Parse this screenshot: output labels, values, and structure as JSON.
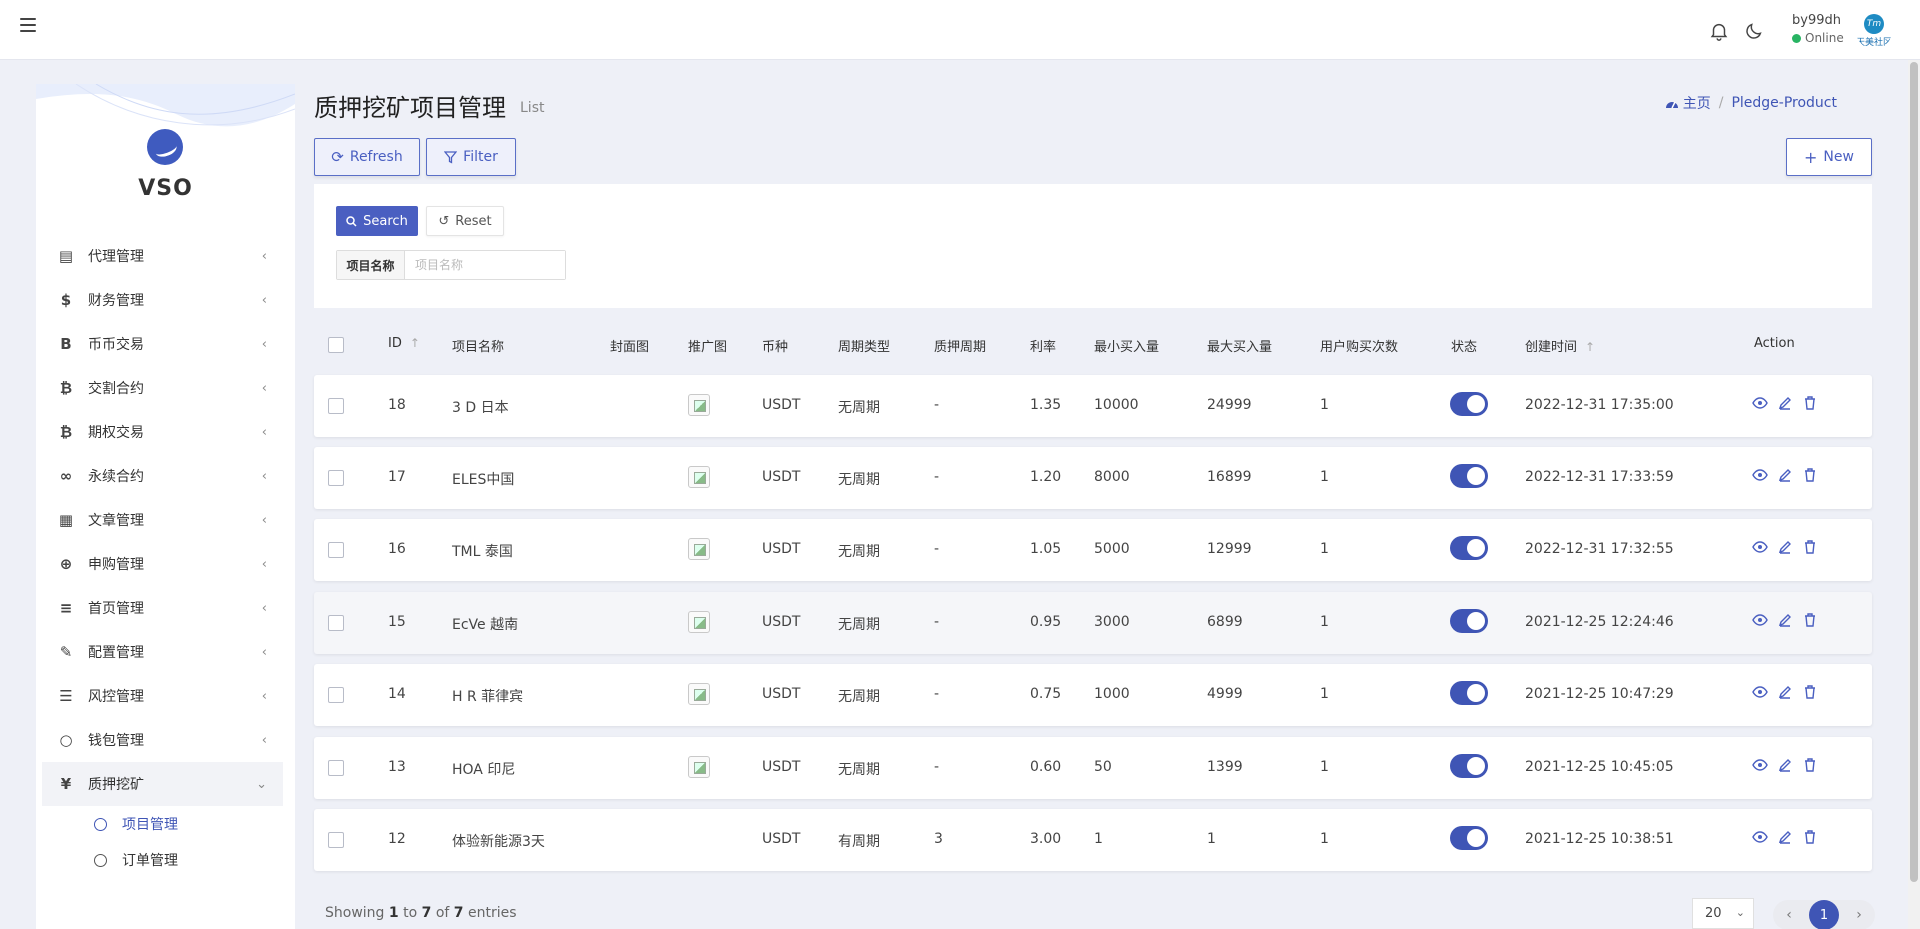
{
  "topbar": {
    "user_name": "by99dh",
    "user_status": "Online",
    "avatar_caption": "天美社区",
    "avatar_logo": "Tm"
  },
  "sidebar": {
    "logo_text": "VSO",
    "items": [
      {
        "label": "代理管理",
        "icon": "id-card-icon",
        "glyph": "▤"
      },
      {
        "label": "财务管理",
        "icon": "dollar-icon",
        "glyph": "$"
      },
      {
        "label": "币币交易",
        "icon": "bitcoin-b-icon",
        "glyph": "B"
      },
      {
        "label": "交割合约",
        "icon": "bitcoin-icon",
        "glyph": "₿"
      },
      {
        "label": "期权交易",
        "icon": "bitcoin-icon",
        "glyph": "₿"
      },
      {
        "label": "永续合约",
        "icon": "link-icon",
        "glyph": "∞"
      },
      {
        "label": "文章管理",
        "icon": "newspaper-icon",
        "glyph": "▦"
      },
      {
        "label": "申购管理",
        "icon": "lifebuoy-icon",
        "glyph": "⊕"
      },
      {
        "label": "首页管理",
        "icon": "list-icon",
        "glyph": "≡"
      },
      {
        "label": "配置管理",
        "icon": "wrench-icon",
        "glyph": "✎"
      },
      {
        "label": "风控管理",
        "icon": "indent-icon",
        "glyph": "☰"
      },
      {
        "label": "钱包管理",
        "icon": "circle-icon",
        "glyph": "○"
      },
      {
        "label": "质押挖矿",
        "icon": "yen-icon",
        "glyph": "¥"
      }
    ],
    "submenu": [
      {
        "label": "项目管理",
        "active": true
      },
      {
        "label": "订单管理",
        "active": false
      }
    ]
  },
  "header": {
    "title": "质押挖矿项目管理",
    "subtitle": "List",
    "breadcrumb_home": "主页",
    "breadcrumb_current": "Pledge-Product"
  },
  "toolbar": {
    "refresh_label": "Refresh",
    "filter_label": "Filter",
    "new_label": "New"
  },
  "filter": {
    "search_label": "Search",
    "reset_label": "Reset",
    "field_label": "项目名称",
    "field_placeholder": "项目名称"
  },
  "table": {
    "columns": [
      "ID",
      "项目名称",
      "封面图",
      "推广图",
      "币种",
      "周期类型",
      "质押周期",
      "利率",
      "最小买入量",
      "最大买入量",
      "用户购买次数",
      "状态",
      "创建时间",
      "Action"
    ],
    "rows": [
      {
        "id": "18",
        "name": "3 D 日本",
        "has_promo": true,
        "currency": "USDT",
        "cycle_type": "无周期",
        "period": "-",
        "rate": "1.35",
        "min": "10000",
        "max": "24999",
        "times": "1",
        "enabled": true,
        "created": "2022-12-31 17:35:00"
      },
      {
        "id": "17",
        "name": "ELES中国",
        "has_promo": true,
        "currency": "USDT",
        "cycle_type": "无周期",
        "period": "-",
        "rate": "1.20",
        "min": "8000",
        "max": "16899",
        "times": "1",
        "enabled": true,
        "created": "2022-12-31 17:33:59"
      },
      {
        "id": "16",
        "name": "TML 泰国",
        "has_promo": true,
        "currency": "USDT",
        "cycle_type": "无周期",
        "period": "-",
        "rate": "1.05",
        "min": "5000",
        "max": "12999",
        "times": "1",
        "enabled": true,
        "created": "2022-12-31 17:32:55"
      },
      {
        "id": "15",
        "name": "EcVe 越南",
        "has_promo": true,
        "currency": "USDT",
        "cycle_type": "无周期",
        "period": "-",
        "rate": "0.95",
        "min": "3000",
        "max": "6899",
        "times": "1",
        "enabled": true,
        "created": "2021-12-25 12:24:46"
      },
      {
        "id": "14",
        "name": "H R 菲律宾",
        "has_promo": true,
        "currency": "USDT",
        "cycle_type": "无周期",
        "period": "-",
        "rate": "0.75",
        "min": "1000",
        "max": "4999",
        "times": "1",
        "enabled": true,
        "created": "2021-12-25 10:47:29"
      },
      {
        "id": "13",
        "name": "HOA 印尼",
        "has_promo": true,
        "currency": "USDT",
        "cycle_type": "无周期",
        "period": "-",
        "rate": "0.60",
        "min": "50",
        "max": "1399",
        "times": "1",
        "enabled": true,
        "created": "2021-12-25 10:45:05"
      },
      {
        "id": "12",
        "name": "体验新能源3天",
        "has_promo": false,
        "currency": "USDT",
        "cycle_type": "有周期",
        "period": "3",
        "rate": "3.00",
        "min": "1",
        "max": "1",
        "times": "1",
        "enabled": true,
        "created": "2021-12-25 10:38:51"
      }
    ]
  },
  "footer": {
    "showing_prefix": "Showing",
    "from": "1",
    "to_word": "to",
    "to": "7",
    "of_word": "of",
    "total": "7",
    "entries_word": "entries",
    "page_size": "20",
    "current_page": "1",
    "prev": "‹",
    "next": "›"
  },
  "colors": {
    "accent": "#3f55b5",
    "online": "#28b463"
  }
}
